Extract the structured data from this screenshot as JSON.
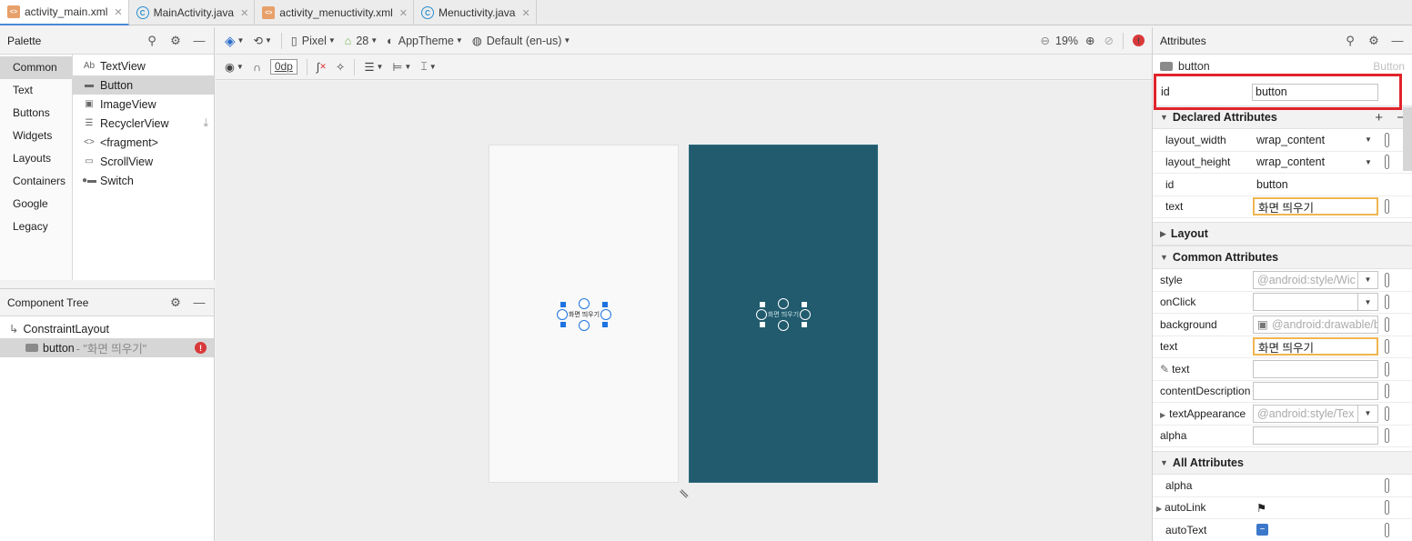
{
  "tabs": [
    {
      "label": "activity_main.xml",
      "type": "xml",
      "active": true
    },
    {
      "label": "MainActivity.java",
      "type": "java",
      "active": false
    },
    {
      "label": "activity_menuctivity.xml",
      "type": "xml",
      "active": false
    },
    {
      "label": "Menuctivity.java",
      "type": "java",
      "active": false
    }
  ],
  "palette": {
    "title": "Palette",
    "categories": [
      "Common",
      "Text",
      "Buttons",
      "Widgets",
      "Layouts",
      "Containers",
      "Google",
      "Legacy"
    ],
    "items": [
      {
        "label": "TextView",
        "icon": "Ab"
      },
      {
        "label": "Button",
        "icon": "▬"
      },
      {
        "label": "ImageView",
        "icon": "▣"
      },
      {
        "label": "RecyclerView",
        "icon": "☰"
      },
      {
        "label": "<fragment>",
        "icon": "<>"
      },
      {
        "label": "ScrollView",
        "icon": "▭"
      },
      {
        "label": "Switch",
        "icon": "●▬"
      }
    ]
  },
  "component_tree": {
    "title": "Component Tree",
    "root": "ConstraintLayout",
    "child_name": "button",
    "child_tag": "- \"화면 띄우기\""
  },
  "toolbar": {
    "device": "Pixel",
    "api": "28",
    "theme": "AppTheme",
    "locale": "Default (en-us)",
    "zoom": "19%",
    "margin": "0dp"
  },
  "canvas": {
    "button_text": "화면 띄우기"
  },
  "attributes": {
    "title": "Attributes",
    "component": "button",
    "component_type": "Button",
    "id_label": "id",
    "id_value": "button",
    "declared_title": "Declared Attributes",
    "declared": [
      {
        "label": "layout_width",
        "value": "wrap_content"
      },
      {
        "label": "layout_height",
        "value": "wrap_content"
      },
      {
        "label": "id",
        "value": "button"
      },
      {
        "label": "text",
        "value": "화면 띄우기"
      }
    ],
    "layout_title": "Layout",
    "common_title": "Common Attributes",
    "common": [
      {
        "label": "style",
        "value": "@android:style/Wic"
      },
      {
        "label": "onClick",
        "value": ""
      },
      {
        "label": "background",
        "value": "@android:drawable/b"
      },
      {
        "label": "text",
        "value": "화면 띄우기"
      },
      {
        "label": "text",
        "value": ""
      },
      {
        "label": "contentDescription",
        "value": ""
      },
      {
        "label": "textAppearance",
        "value": "@android:style/Tex"
      },
      {
        "label": "alpha",
        "value": ""
      }
    ],
    "all_title": "All Attributes",
    "all": [
      {
        "label": "alpha",
        "value": ""
      },
      {
        "label": "autoLink",
        "value": ""
      },
      {
        "label": "autoText",
        "value": ""
      }
    ]
  },
  "colors": {
    "accent": "#1e73e0",
    "dark_screen": "#215b6d",
    "highlight_red": "#e0242a",
    "edited_orange": "#f0b550"
  }
}
